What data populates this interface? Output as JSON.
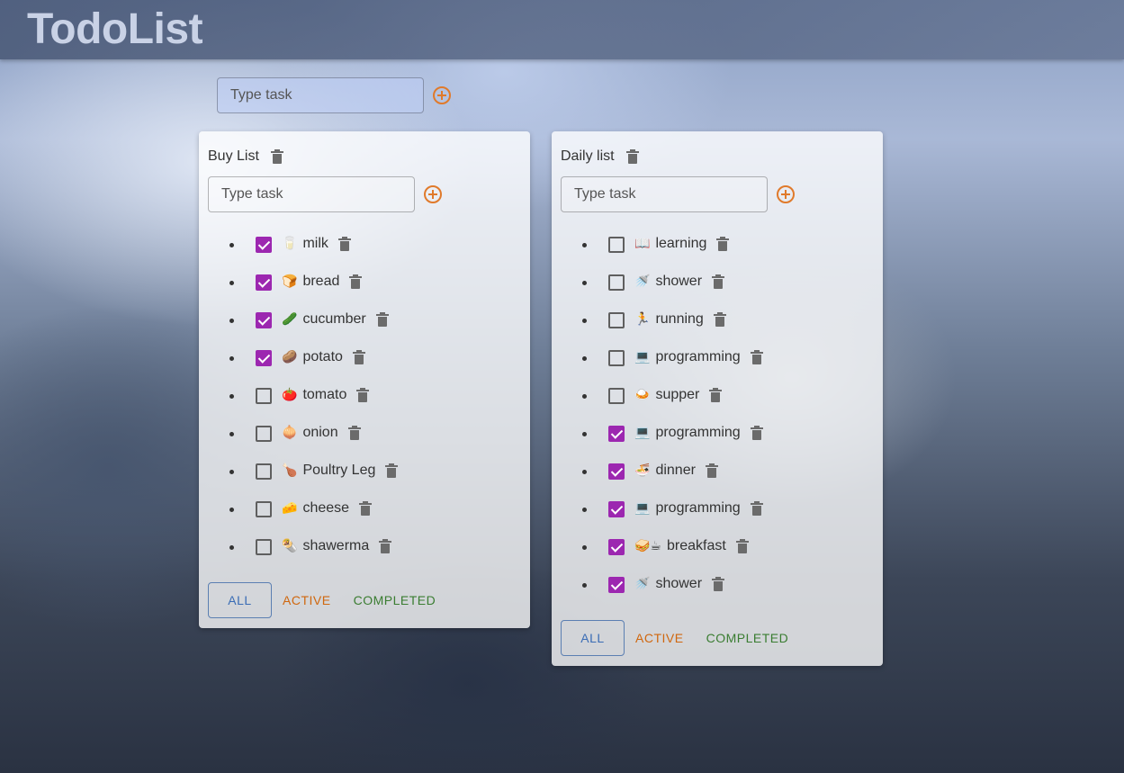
{
  "app": {
    "title": "TodoList"
  },
  "main_input": {
    "placeholder": "Type task"
  },
  "lists": [
    {
      "title": "Buy List",
      "input_placeholder": "Type task",
      "tasks": [
        {
          "emoji": "🥛",
          "text": "milk",
          "done": true
        },
        {
          "emoji": "🍞",
          "text": "bread",
          "done": true
        },
        {
          "emoji": "🥒",
          "text": "cucumber",
          "done": true
        },
        {
          "emoji": "🥔",
          "text": "potato",
          "done": true
        },
        {
          "emoji": "🍅",
          "text": "tomato",
          "done": false
        },
        {
          "emoji": "🧅",
          "text": "onion",
          "done": false
        },
        {
          "emoji": "🍗",
          "text": "Poultry Leg",
          "done": false
        },
        {
          "emoji": "🧀",
          "text": "cheese",
          "done": false
        },
        {
          "emoji": "🌯",
          "text": "shawerma",
          "done": false
        }
      ],
      "filters": {
        "all": "ALL",
        "active": "ACTIVE",
        "completed": "COMPLETED"
      }
    },
    {
      "title": "Daily list",
      "input_placeholder": "Type task",
      "tasks": [
        {
          "emoji": "📖",
          "text": "learning",
          "done": false
        },
        {
          "emoji": "🚿",
          "text": "shower",
          "done": false
        },
        {
          "emoji": "🏃",
          "text": "running",
          "done": false
        },
        {
          "emoji": "💻",
          "text": "programming",
          "done": false
        },
        {
          "emoji": "🍛",
          "text": "supper",
          "done": false
        },
        {
          "emoji": "💻",
          "text": "programming",
          "done": true
        },
        {
          "emoji": "🍜",
          "text": "dinner",
          "done": true
        },
        {
          "emoji": "💻",
          "text": "programming",
          "done": true
        },
        {
          "emoji": "🥪☕",
          "text": "breakfast",
          "done": true
        },
        {
          "emoji": "🚿",
          "text": "shower",
          "done": true
        }
      ],
      "filters": {
        "all": "ALL",
        "active": "ACTIVE",
        "completed": "COMPLETED"
      }
    }
  ],
  "colors": {
    "checkbox_checked": "#9c27b0",
    "add_icon": "#e07a2b",
    "filter_all": "#3a6cb5",
    "filter_active": "#d0670e",
    "filter_completed": "#3a7d31"
  }
}
